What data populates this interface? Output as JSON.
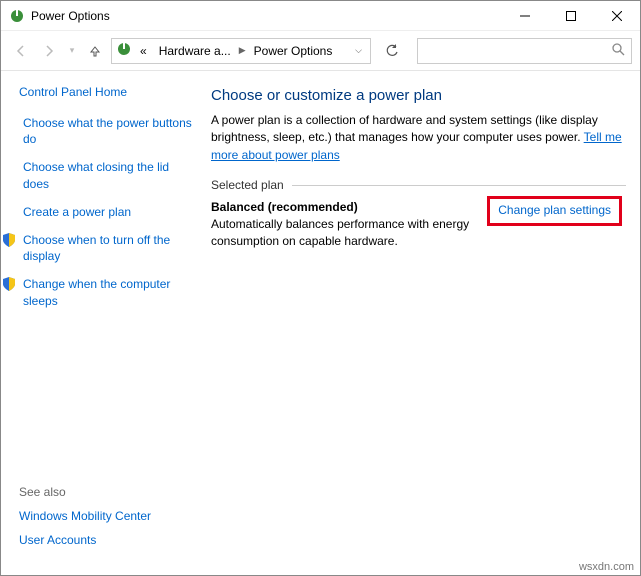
{
  "window": {
    "title": "Power Options"
  },
  "breadcrumb": {
    "back_title": "«",
    "item1": "Hardware a...",
    "item2": "Power Options"
  },
  "search": {
    "placeholder": ""
  },
  "sidebar": {
    "home": "Control Panel Home",
    "tasks": [
      "Choose what the power buttons do",
      "Choose what closing the lid does",
      "Create a power plan",
      "Choose when to turn off the display",
      "Change when the computer sleeps"
    ],
    "see_also_title": "See also",
    "see_also": [
      "Windows Mobility Center",
      "User Accounts"
    ]
  },
  "main": {
    "heading": "Choose or customize a power plan",
    "description": "A power plan is a collection of hardware and system settings (like display brightness, sleep, etc.) that manages how your computer uses power. ",
    "learn_more": "Tell me more about power plans",
    "section": "Selected plan",
    "plan_name": "Balanced (recommended)",
    "plan_desc": "Automatically balances performance with energy consumption on capable hardware.",
    "change_link": "Change plan settings"
  },
  "watermark": "wsxdn.com"
}
